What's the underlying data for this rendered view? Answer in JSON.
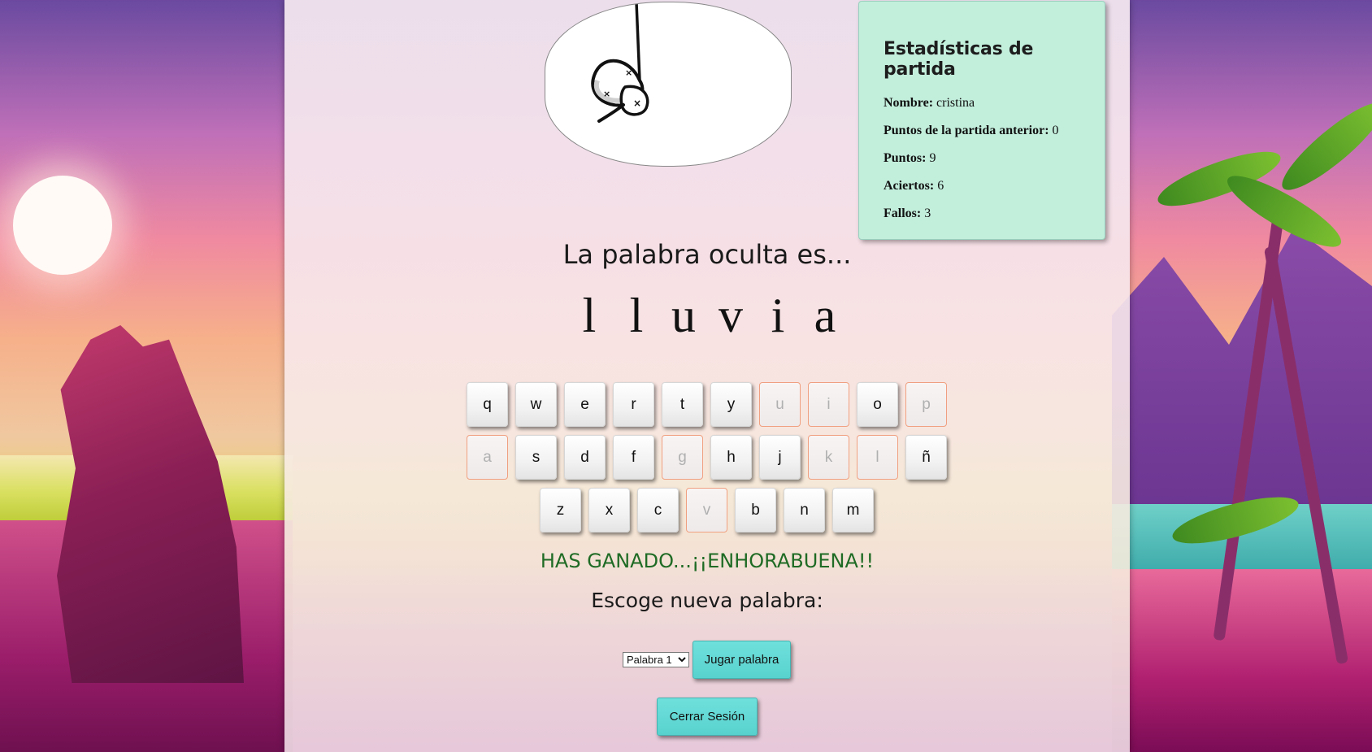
{
  "hangman": {
    "image_alt": "hangman drawing"
  },
  "stats": {
    "title": "Estadísticas de partida",
    "rows": [
      {
        "label": "Nombre:",
        "value": "cristina"
      },
      {
        "label": "Puntos de la partida anterior:",
        "value": "0"
      },
      {
        "label": "Puntos:",
        "value": "9"
      },
      {
        "label": "Aciertos:",
        "value": "6"
      },
      {
        "label": "Fallos:",
        "value": "3"
      }
    ]
  },
  "game": {
    "hidden_title": "La palabra oculta es...",
    "word_letters": [
      "l",
      "l",
      "u",
      "v",
      "i",
      "a"
    ]
  },
  "keyboard": {
    "rows": [
      [
        {
          "key": "q",
          "used": false
        },
        {
          "key": "w",
          "used": false
        },
        {
          "key": "e",
          "used": false
        },
        {
          "key": "r",
          "used": false
        },
        {
          "key": "t",
          "used": false
        },
        {
          "key": "y",
          "used": false
        },
        {
          "key": "u",
          "used": true
        },
        {
          "key": "i",
          "used": true
        },
        {
          "key": "o",
          "used": false
        },
        {
          "key": "p",
          "used": true
        }
      ],
      [
        {
          "key": "a",
          "used": true
        },
        {
          "key": "s",
          "used": false
        },
        {
          "key": "d",
          "used": false
        },
        {
          "key": "f",
          "used": false
        },
        {
          "key": "g",
          "used": true
        },
        {
          "key": "h",
          "used": false
        },
        {
          "key": "j",
          "used": false
        },
        {
          "key": "k",
          "used": true
        },
        {
          "key": "l",
          "used": true
        },
        {
          "key": "ñ",
          "used": false
        }
      ],
      [
        {
          "key": "z",
          "used": false
        },
        {
          "key": "x",
          "used": false
        },
        {
          "key": "c",
          "used": false
        },
        {
          "key": "v",
          "used": true
        },
        {
          "key": "b",
          "used": false
        },
        {
          "key": "n",
          "used": false
        },
        {
          "key": "m",
          "used": false
        }
      ]
    ]
  },
  "result": {
    "message": "HAS GANADO...¡¡ENHORABUENA!!",
    "choose_label": "Escoge nueva palabra:"
  },
  "controls": {
    "word_select_value": "Palabra 1",
    "play_button": "Jugar palabra",
    "logout_button": "Cerrar Sesión"
  },
  "colors": {
    "stats_bg": "#c2eedc",
    "button_accent": "#58d2ce",
    "win_text": "#1f6b25",
    "used_key_border": "#f0a080"
  }
}
